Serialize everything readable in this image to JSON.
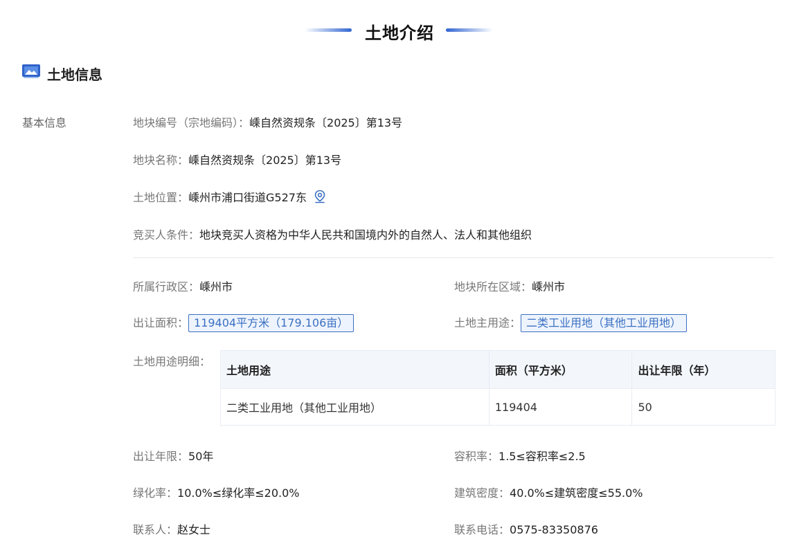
{
  "page": {
    "title": "土地介绍",
    "section_title": "土地信息",
    "side_label": "基本信息"
  },
  "basic": {
    "parcel_code_label": "地块编号（宗地编码）：",
    "parcel_code_value": "嵊自然资规条〔2025〕第13号",
    "parcel_name_label": "地块名称：",
    "parcel_name_value": "嵊自然资规条〔2025〕第13号",
    "location_label": "土地位置：",
    "location_value": "嵊州市浦口街道G527东",
    "bidder_label": "竞买人条件：",
    "bidder_value": "地块竞买人资格为中华人民共和国境内外的自然人、法人和其他组织"
  },
  "details": {
    "district_label": "所属行政区：",
    "district_value": "嵊州市",
    "area_region_label": "地块所在区域：",
    "area_region_value": "嵊州市",
    "transfer_area_label": "出让面积：",
    "transfer_area_value": "119404平方米（179.106亩）",
    "main_use_label": "土地主用途：",
    "main_use_value": "二类工业用地（其他工业用地）",
    "use_detail_label": "土地用途明细："
  },
  "usage_table": {
    "headers": [
      "土地用途",
      "面积（平方米）",
      "出让年限（年）"
    ],
    "rows": [
      [
        "二类工业用地（其他工业用地）",
        "119404",
        "50"
      ]
    ]
  },
  "extra": {
    "term_label": "出让年限：",
    "term_value": "50年",
    "far_label": "容积率：",
    "far_value": "1.5≤容积率≤2.5",
    "green_label": "绿化率：",
    "green_value": "10.0%≤绿化率≤20.0%",
    "density_label": "建筑密度：",
    "density_value": "40.0%≤建筑密度≤55.0%",
    "contact_label": "联系人：",
    "contact_value": "赵女士",
    "phone_label": "联系电话：",
    "phone_value": "0575-83350876"
  },
  "icons": {
    "section": "image-icon",
    "location": "location-pin-icon"
  },
  "colors": {
    "accent": "#3266d2",
    "tag_border": "#3a6fc2",
    "table_header_bg": "#f3f7fc"
  }
}
